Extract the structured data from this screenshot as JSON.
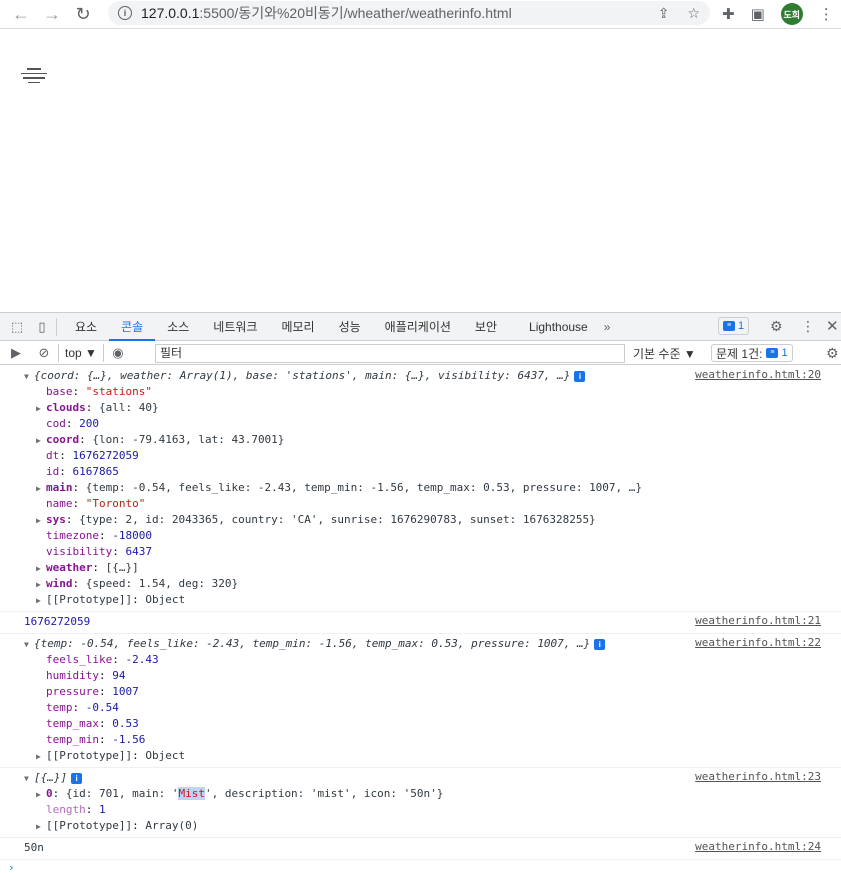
{
  "browser": {
    "url_host": "127.0.0.1",
    "url_path": ":5500/동기와%20비동기/wheather/weatherinfo.html",
    "avatar_text": "도희"
  },
  "devtools": {
    "tabs": [
      "요소",
      "콘솔",
      "소스",
      "네트워크",
      "메모리",
      "성능",
      "애플리케이션",
      "보안",
      "Lighthouse"
    ],
    "active_tab": "콘솔",
    "more": "»",
    "message_badge": "1",
    "context": "top ▼",
    "filter_placeholder": "필터",
    "levels": "기본 수준 ▼",
    "issues_label": "문제 1건:",
    "issues_count": "1"
  },
  "console": {
    "m1": {
      "summary": "{coord: {…}, weather: Array(1), base: 'stations', main: {…}, visibility: 6437, …}",
      "source": "weatherinfo.html:20",
      "base": "\"stations\"",
      "clouds": "{all: 40}",
      "cod": "200",
      "coord": "{lon: -79.4163, lat: 43.7001}",
      "dt": "1676272059",
      "id": "6167865",
      "main": "{temp: -0.54, feels_like: -2.43, temp_min: -1.56, temp_max: 0.53, pressure: 1007, …}",
      "name": "\"Toronto\"",
      "sys": "{type: 2, id: 2043365, country: 'CA', sunrise: 1676290783, sunset: 1676328255}",
      "timezone": "-18000",
      "visibility": "6437",
      "weather": "[{…}]",
      "wind": "{speed: 1.54, deg: 320}",
      "proto": "Object"
    },
    "m2": {
      "text": "1676272059",
      "source": "weatherinfo.html:21"
    },
    "m3": {
      "summary": "{temp: -0.54, feels_like: -2.43, temp_min: -1.56, temp_max: 0.53, pressure: 1007, …}",
      "source": "weatherinfo.html:22",
      "feels_like": "-2.43",
      "humidity": "94",
      "pressure": "1007",
      "temp": "-0.54",
      "temp_max": "0.53",
      "temp_min": "-1.56",
      "proto": "Object"
    },
    "m4": {
      "summary": "[{…}]",
      "source": "weatherinfo.html:23",
      "item0_pre": "{id: 701, main: '",
      "item0_hl": "Mist",
      "item0_post": "', description: 'mist', icon: '50n'}",
      "length": "1",
      "proto": "Array(0)"
    },
    "m5": {
      "text": "50n",
      "source": "weatherinfo.html:24"
    }
  }
}
